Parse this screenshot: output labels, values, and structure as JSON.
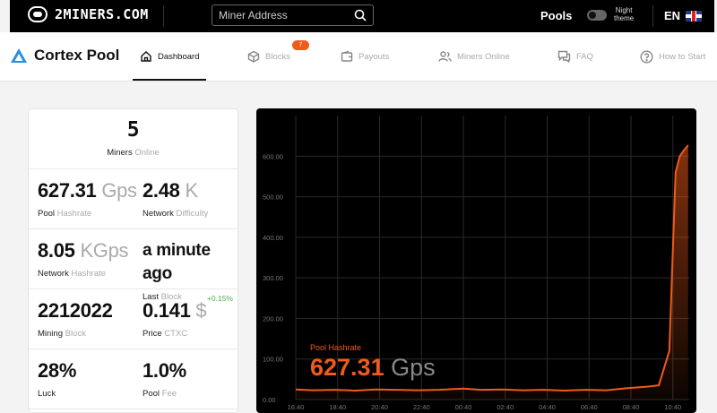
{
  "topbar": {
    "brand": "2MINERS.COM",
    "search_placeholder": "Miner Address",
    "pools_label": "Pools",
    "night_theme_line1": "Night",
    "night_theme_line2": "theme",
    "lang": "EN"
  },
  "nav": {
    "pool_name": "Cortex Pool",
    "items": [
      {
        "label": "Dashboard",
        "icon": "home-icon",
        "active": true
      },
      {
        "label": "Blocks",
        "icon": "cube-icon",
        "badge": "7"
      },
      {
        "label": "Payouts",
        "icon": "wallet-icon"
      },
      {
        "label": "Miners Online",
        "icon": "users-icon"
      },
      {
        "label": "FAQ",
        "icon": "chat-icon"
      },
      {
        "label": "How to Start",
        "icon": "question-icon"
      }
    ]
  },
  "stats": {
    "miners": {
      "value": "5",
      "label": "Miners",
      "label_grey": "Online"
    },
    "pool_hashrate": {
      "value": "627.31",
      "unit": "Gps",
      "label": "Pool",
      "label_grey": "Hashrate"
    },
    "network_difficulty": {
      "value": "2.48",
      "unit": "K",
      "label": "Network",
      "label_grey": "Difficulty"
    },
    "network_hashrate": {
      "value": "8.05",
      "unit": "KGps",
      "label": "Network",
      "label_grey": "Hashrate"
    },
    "last_block": {
      "value": "a minute ago",
      "label": "Last",
      "label_grey": "Block"
    },
    "mining_block": {
      "value": "2212022",
      "label": "Mining",
      "label_grey": "Block"
    },
    "price": {
      "value": "0.141",
      "unit": "$",
      "label": "Price",
      "label_grey": "CTXC",
      "delta": "+0.15%"
    },
    "luck": {
      "value": "28%",
      "label": "Luck"
    },
    "pool_fee": {
      "value": "1.0%",
      "label": "Pool",
      "label_grey": "Fee"
    }
  },
  "chart_data": {
    "type": "area",
    "series": [
      {
        "name": "Pool Hashrate"
      }
    ],
    "current_label": "Pool Hashrate",
    "current_value": "627.31",
    "current_unit": "Gps",
    "x_ticks": [
      "16:40",
      "18:40",
      "20:40",
      "22:40",
      "00:40",
      "02:40",
      "04:40",
      "06:40",
      "08:40",
      "10:40"
    ],
    "y_ticks": [
      "0.00",
      "100.00",
      "200.00",
      "300.00",
      "400.00",
      "500.00",
      "600.00"
    ],
    "ylim": [
      0,
      700
    ],
    "x_hours": [
      16.67,
      17.5,
      18.5,
      19.5,
      20.5,
      21.5,
      22.5,
      23.5,
      24.67,
      25.5,
      26.5,
      27.5,
      28.5,
      29.5,
      30.5,
      31.5,
      32.5,
      33.5,
      34.0,
      34.5,
      34.8,
      35.0,
      35.2,
      35.4
    ],
    "values": [
      25,
      23,
      24,
      22,
      25,
      24,
      23,
      24,
      27,
      24,
      25,
      23,
      24,
      22,
      24,
      23,
      28,
      32,
      35,
      120,
      560,
      600,
      615,
      627
    ],
    "accent": "#f05a1a",
    "grid": true
  }
}
